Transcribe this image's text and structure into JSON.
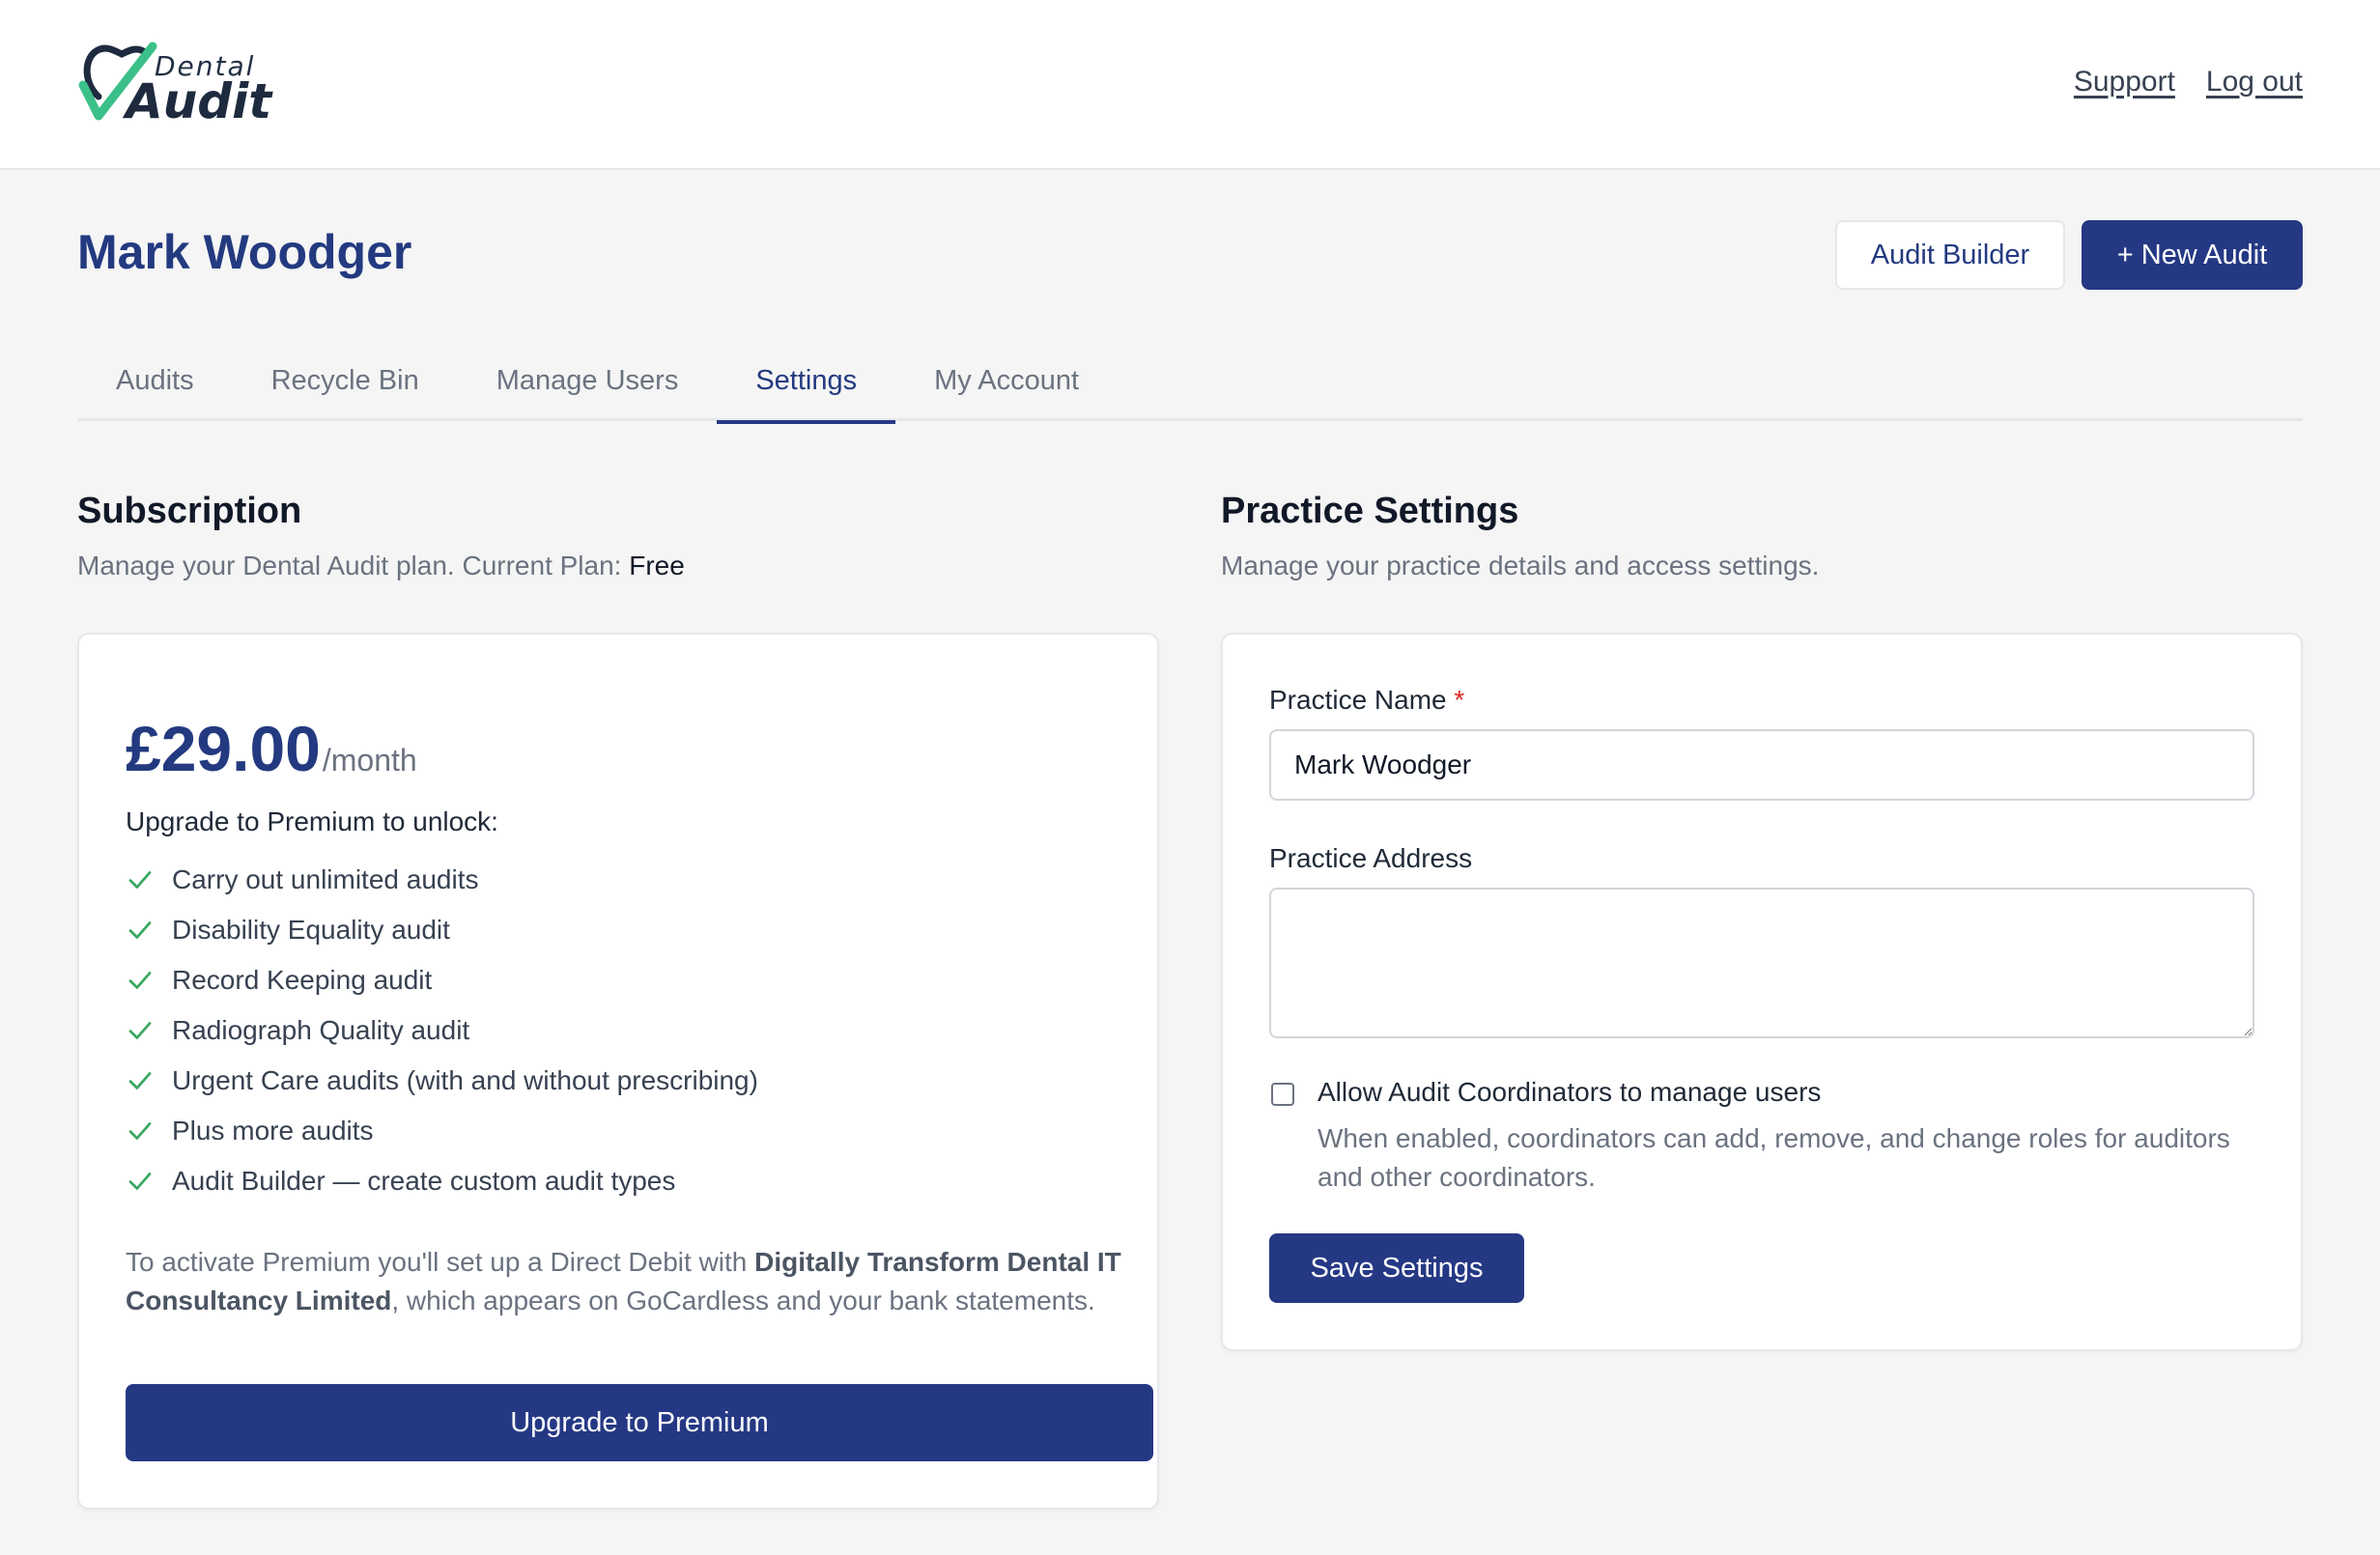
{
  "brand": {
    "small": "Dental",
    "big": "Audit",
    "accent": "#3cc08a",
    "dark": "#1e2b3f"
  },
  "header": {
    "support": "Support",
    "logout": "Log out"
  },
  "page": {
    "title": "Mark Woodger",
    "audit_builder": "Audit Builder",
    "new_audit": "+ New Audit"
  },
  "tabs": [
    {
      "label": "Audits"
    },
    {
      "label": "Recycle Bin"
    },
    {
      "label": "Manage Users"
    },
    {
      "label": "Settings"
    },
    {
      "label": "My Account"
    }
  ],
  "active_tab": "Settings",
  "subscription": {
    "title": "Subscription",
    "subtitle": "Manage your Dental Audit plan. Current Plan:",
    "current_plan": "Free",
    "price": "£29.00",
    "period": "/month",
    "unlock": "Upgrade to Premium to unlock:",
    "features": [
      "Carry out unlimited audits",
      "Disability Equality audit",
      "Record Keeping audit",
      "Radiograph Quality audit",
      "Urgent Care audits (with and without prescribing)",
      "Plus more audits",
      "Audit Builder — create custom audit types"
    ],
    "activate_pre": "To activate Premium you'll set up a Direct Debit with",
    "activate_company": "Digitally Transform Dental IT Consultancy Limited",
    "activate_post": ", which appears on GoCardless and your bank statements.",
    "upgrade_button": "Upgrade to Premium"
  },
  "practice": {
    "title": "Practice Settings",
    "subtitle": "Manage your practice details and access settings.",
    "name_label": "Practice Name",
    "required_mark": "*",
    "name_value": "Mark Woodger",
    "address_label": "Practice Address",
    "address_value": "",
    "coord_label": "Allow Audit Coordinators to manage users",
    "coord_help": "When enabled, coordinators can add, remove, and change roles for auditors and other coordinators.",
    "coord_checked": false,
    "save_button": "Save Settings"
  }
}
